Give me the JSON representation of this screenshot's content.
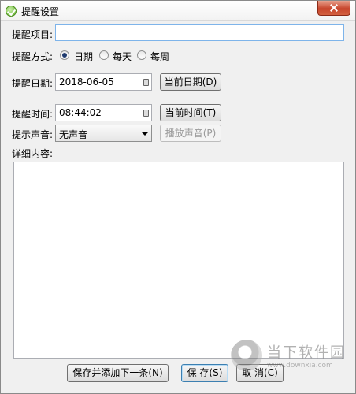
{
  "window": {
    "title": "提醒设置"
  },
  "form": {
    "item_label": "提醒项目:",
    "item_value": "",
    "mode_label": "提醒方式:",
    "modes": [
      {
        "label": "日期",
        "checked": true
      },
      {
        "label": "每天",
        "checked": false
      },
      {
        "label": "每周",
        "checked": false
      }
    ],
    "date_label": "提醒日期:",
    "date_value": "2018-06-05",
    "current_date_button": "当前日期(D)",
    "time_label": "提醒时间:",
    "time_value": "08:44:02",
    "current_time_button": "当前时间(T)",
    "sound_label": "提示声音:",
    "sound_value": "无声音",
    "play_sound_button": "播放声音(P)",
    "details_label": "详细内容:",
    "details_value": ""
  },
  "footer": {
    "save_and_add": "保存并添加下一条(N)",
    "save": "保 存(S)",
    "cancel": "取 消(C)"
  },
  "watermark": {
    "name": "当下软件园",
    "url": "www.downxia.com"
  }
}
